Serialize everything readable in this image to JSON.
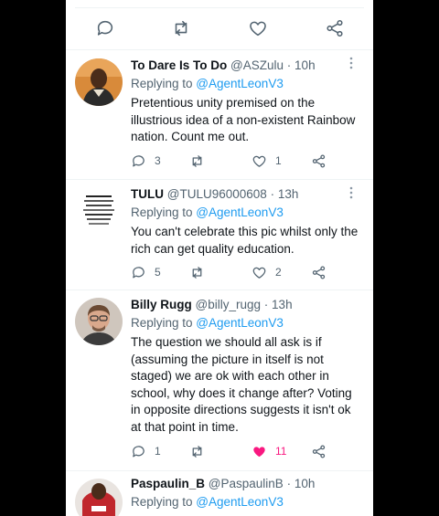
{
  "top_actions": [
    "reply-icon",
    "retweet-icon",
    "like-icon",
    "share-icon"
  ],
  "tweets": [
    {
      "name": "To Dare Is To Do",
      "handle": "@ASZulu",
      "dot": "·",
      "time": "10h",
      "replying_prefix": "Replying to ",
      "replying_to": "@AgentLeonV3",
      "text": "Pretentious unity premised on the illustrious idea of a non-existent Rainbow nation. Count me out.",
      "replies": "3",
      "retweets": "",
      "likes": "1"
    },
    {
      "name": "TULU",
      "handle": "@TULU96000608",
      "dot": "·",
      "time": "13h",
      "replying_prefix": "Replying to ",
      "replying_to": "@AgentLeonV3",
      "text": "You can't celebrate this pic whilst only the rich can get quality education.",
      "replies": "5",
      "retweets": "",
      "likes": "2"
    },
    {
      "name": "Billy Rugg",
      "handle": "@billy_rugg",
      "dot": "·",
      "time": "13h",
      "replying_prefix": "Replying to ",
      "replying_to": "@AgentLeonV3",
      "text": "The question we should all ask is if (assuming the picture in itself is not staged) we are ok with each other in school, why does it change after? Voting in opposite directions suggests it isn't ok at that point in time.",
      "replies": "1",
      "retweets": "",
      "likes": "11",
      "liked": true
    },
    {
      "name": "Paspaulin_B",
      "handle": "@PaspaulinB",
      "dot": "·",
      "time": "10h",
      "replying_prefix": "Replying to ",
      "replying_to": "@AgentLeonV3"
    }
  ],
  "colors": {
    "accent": "#1d9bf0",
    "like": "#f91880",
    "muted": "#536471",
    "text": "#0f1419"
  }
}
